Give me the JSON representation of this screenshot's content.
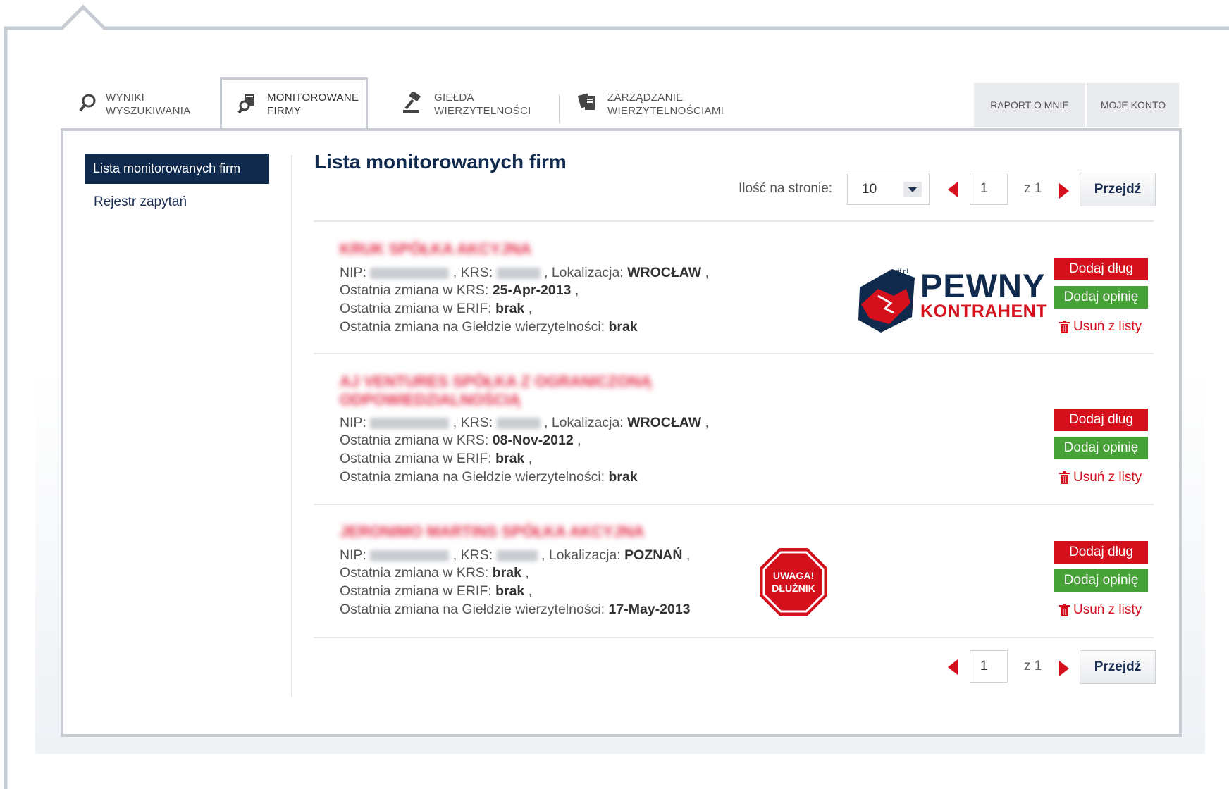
{
  "tabs": [
    {
      "label": "WYNIKI\nWYSZUKIWANIA",
      "icon": "search-icon"
    },
    {
      "label": "MONITOROWANE\nFIRMY",
      "icon": "monitor-icon"
    },
    {
      "label": "GIEŁDA\nWIERZYTELNOŚCI",
      "icon": "gavel-icon"
    },
    {
      "label": "ZARZĄDZANIE\nWIERZYTELNOŚCIAMI",
      "icon": "docs-hand-icon"
    }
  ],
  "right_tabs": [
    "RAPORT O MNIE",
    "MOJE KONTO"
  ],
  "sidebar": {
    "items": [
      "Lista monitorowanych firm",
      "Rejestr zapytań"
    ]
  },
  "main": {
    "title": "Lista monitorowanych firm",
    "per_page_label": "Ilość na stronie:",
    "per_page_value": "10",
    "page": "1",
    "of_text": "z 1",
    "go_label": "Przejdź"
  },
  "labels": {
    "nip": "NIP:",
    "krs": ", KRS:",
    "lokalizacja": ", Lokalizacja:",
    "krs_change": "Ostatnia zmiana w KRS:",
    "erif_change": "Ostatnia zmiana w ERIF:",
    "gielda_change": "Ostatnia zmiana na Giełdzie wierzytelności:",
    "sep": ","
  },
  "companies": [
    {
      "name": "KRUK SPÓŁKA AKCYJNA",
      "location": "WROCŁAW",
      "krs_change": "25-Apr-2013",
      "erif_change": "brak",
      "gielda_change": "brak"
    },
    {
      "name": "AJ VENTURES SPÓŁKA Z OGRANICZONĄ ODPOWIEDZIALNOŚCIĄ",
      "location": "WROCŁAW",
      "krs_change": "08-Nov-2012",
      "erif_change": "brak",
      "gielda_change": "brak"
    },
    {
      "name": "JERONIMO MARTINS SPÓŁKA AKCYJNA",
      "location": "POZNAŃ",
      "krs_change": "brak",
      "erif_change": "brak",
      "gielda_change": "17-May-2013"
    }
  ],
  "actions": {
    "add_debt": "Dodaj dług",
    "add_opinion": "Dodaj opinię",
    "remove": "Usuń z listy"
  },
  "badges": {
    "pewny_small": "verif.pl",
    "pewny_line1": "PEWNY",
    "pewny_line2": "KONTRAHENT",
    "uwaga": "UWAGA!\nDŁUŻNIK"
  },
  "colors": {
    "navy": "#102a4e",
    "red": "#d3101c",
    "green": "#46a137"
  }
}
